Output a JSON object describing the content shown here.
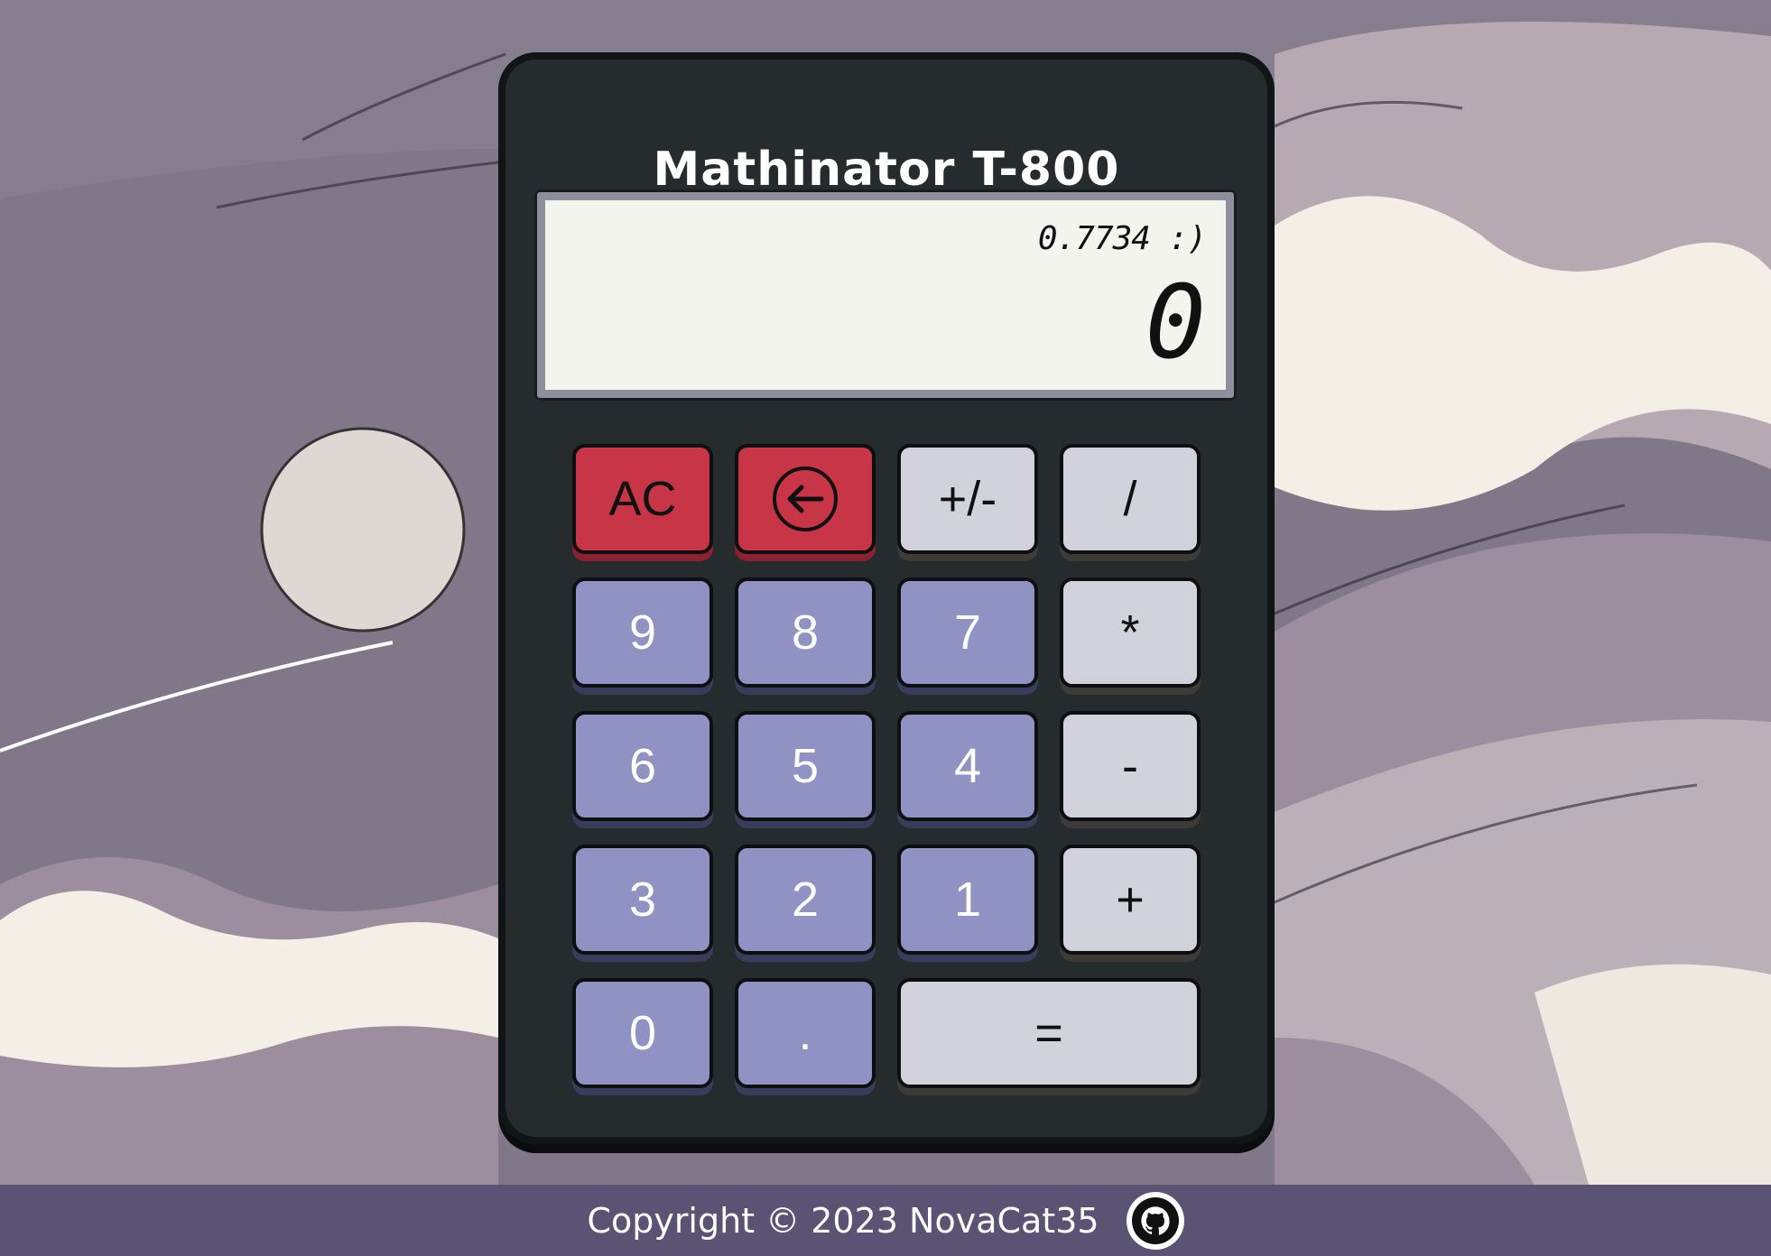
{
  "calculator": {
    "title": "Mathinator T-800",
    "display": {
      "previous": "0.7734 :)",
      "current": "0"
    },
    "keys": {
      "clear": "AC",
      "backspace_icon": "arrow-left-circle-icon",
      "negate": "+/-",
      "divide": "/",
      "nine": "9",
      "eight": "8",
      "seven": "7",
      "multiply": "*",
      "six": "6",
      "five": "5",
      "four": "4",
      "subtract": "-",
      "three": "3",
      "two": "2",
      "one": "1",
      "add": "+",
      "zero": "0",
      "decimal": ".",
      "equals": "="
    }
  },
  "footer": {
    "copyright": "Copyright © 2023 NovaCat35",
    "github_icon": "github-icon"
  },
  "colors": {
    "body": "#262b2e",
    "function_key": "#c83546",
    "number_key": "#8f92c3",
    "operator_key": "#d2d2dc",
    "footer_bar": "#5a5374",
    "screen": "#f4f4ee"
  }
}
